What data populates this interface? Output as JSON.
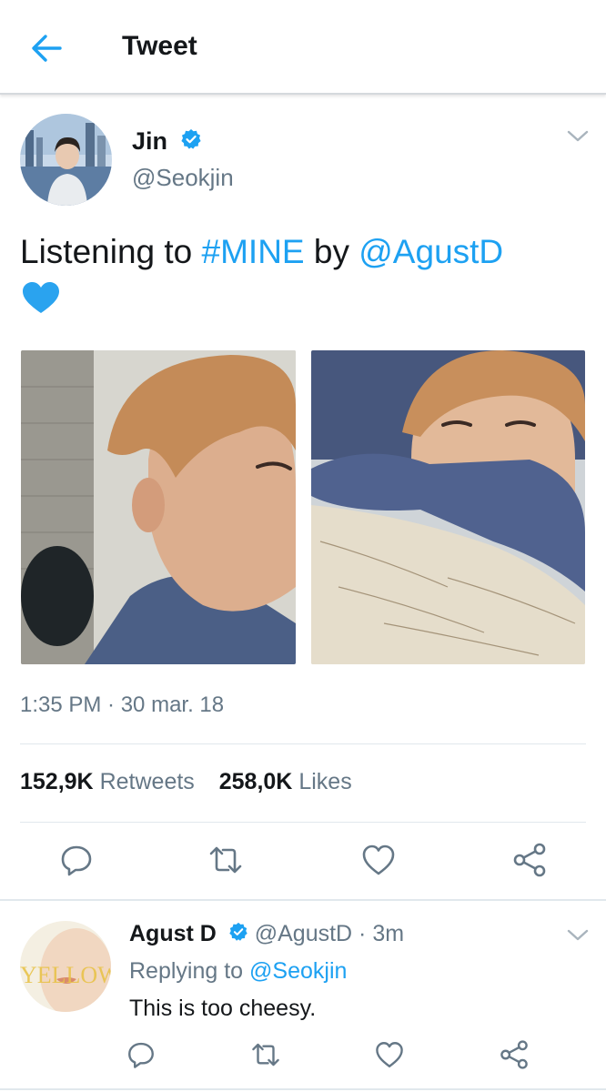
{
  "header": {
    "title": "Tweet"
  },
  "tweet": {
    "display_name": "Jin",
    "handle": "@Seokjin",
    "text_prefix": "Listening to ",
    "hashtag": "#MINE",
    "text_mid": " by ",
    "mention": "@AgustD",
    "timestamp": "1:35 PM · 30 mar. 18",
    "retweet_count": "152,9K",
    "retweet_label": "Retweets",
    "like_count": "258,0K",
    "like_label": "Likes"
  },
  "reply": {
    "display_name": "Agust D",
    "handle": "@AgustD",
    "separator": " · ",
    "time": "3m",
    "replying_prefix": "Replying to ",
    "replying_to": "@Seokjin",
    "text": "This is too cheesy."
  },
  "colors": {
    "accent": "#1da1f2",
    "secondary_text": "#657786",
    "heart": "#2aa3ef"
  },
  "icons": {
    "back": "back-arrow-icon",
    "verified": "verified-badge-icon",
    "caret": "chevron-down-icon",
    "reply": "reply-icon",
    "retweet": "retweet-icon",
    "like": "like-icon",
    "share": "share-icon",
    "emoji": "blue-heart-emoji"
  }
}
